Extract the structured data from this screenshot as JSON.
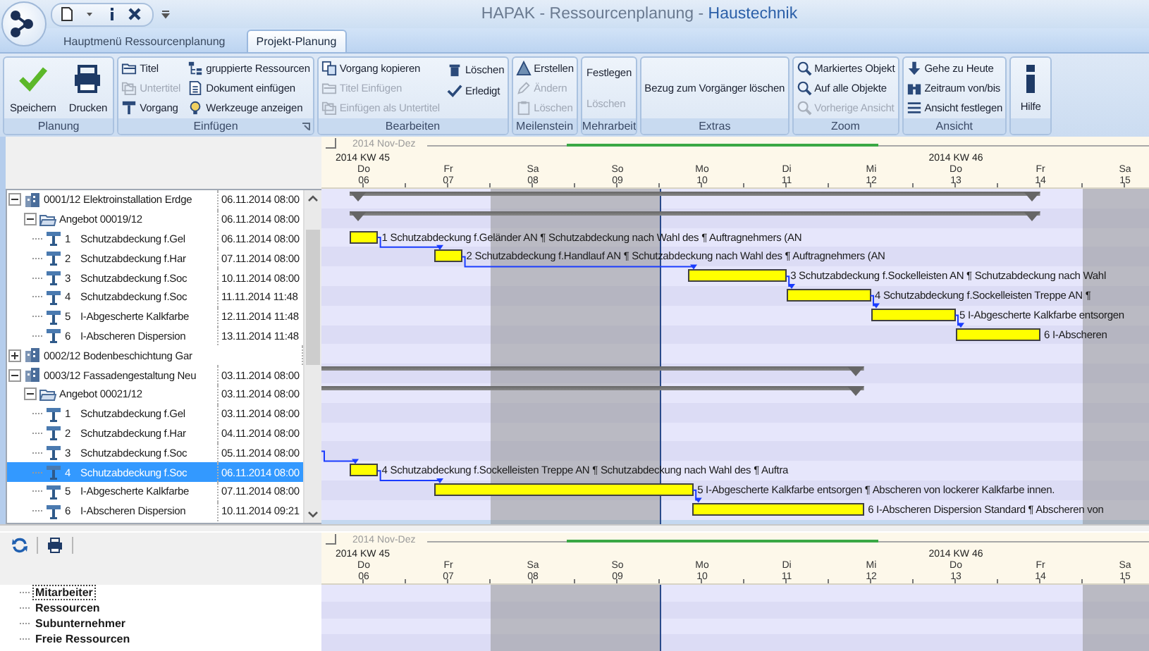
{
  "window": {
    "title": "HAPAK - Ressourcenplanung - ",
    "document": "Haustechnik"
  },
  "tabs": [
    {
      "label": "Hauptmenü Ressourcenplanung",
      "selected": false
    },
    {
      "label": "Projekt-Planung",
      "selected": true
    }
  ],
  "ribbon": {
    "groups": [
      {
        "label": "Planung",
        "columns": [
          [
            {
              "kind": "large",
              "label": "Speichern",
              "disabled": false
            }
          ],
          [
            {
              "kind": "large",
              "label": "Drucken",
              "disabled": false
            }
          ]
        ]
      },
      {
        "label": "Einfügen",
        "launcher": true,
        "columns": [
          [
            {
              "kind": "small",
              "label": "Titel",
              "disabled": false
            },
            {
              "kind": "small",
              "label": "Untertitel",
              "disabled": true
            },
            {
              "kind": "small",
              "label": "Vorgang",
              "disabled": false
            }
          ],
          [
            {
              "kind": "small",
              "label": "gruppierte Ressourcen",
              "disabled": false
            },
            {
              "kind": "small",
              "label": "Dokument einfügen",
              "disabled": false
            },
            {
              "kind": "small",
              "label": "Werkzeuge anzeigen",
              "disabled": false
            }
          ]
        ]
      },
      {
        "label": "Bearbeiten",
        "columns": [
          [
            {
              "kind": "small",
              "label": "Vorgang kopieren",
              "disabled": false
            },
            {
              "kind": "small",
              "label": "Titel Einfügen",
              "disabled": true
            },
            {
              "kind": "small",
              "label": "Einfügen als Untertitel",
              "disabled": true
            }
          ],
          [
            {
              "kind": "small",
              "label": "Löschen",
              "disabled": false
            },
            {
              "kind": "small",
              "label": "Erledigt",
              "disabled": false
            }
          ]
        ]
      },
      {
        "label": "Meilenstein",
        "columns": [
          [
            {
              "kind": "small",
              "label": "Erstellen",
              "disabled": false
            },
            {
              "kind": "small",
              "label": "Ändern",
              "disabled": true
            },
            {
              "kind": "small",
              "label": "Löschen",
              "disabled": true
            }
          ]
        ]
      },
      {
        "label": "Mehrarbeit",
        "columns": [
          [
            {
              "kind": "text",
              "label": "Festlegen",
              "disabled": false
            },
            {
              "kind": "text",
              "label": "Löschen",
              "disabled": true
            }
          ]
        ]
      },
      {
        "label": "Extras",
        "columns": [
          [
            {
              "kind": "text",
              "label": "Bezug zum Vorgänger löschen",
              "disabled": false
            }
          ]
        ]
      },
      {
        "label": "Zoom",
        "columns": [
          [
            {
              "kind": "small",
              "label": "Markiertes Objekt",
              "disabled": false
            },
            {
              "kind": "small",
              "label": "Auf alle Objekte",
              "disabled": false
            },
            {
              "kind": "small",
              "label": "Vorherige Ansicht",
              "disabled": true
            }
          ]
        ]
      },
      {
        "label": "Ansicht",
        "columns": [
          [
            {
              "kind": "small",
              "label": "Gehe zu Heute",
              "disabled": false
            },
            {
              "kind": "small",
              "label": "Zeitraum von/bis",
              "disabled": false
            },
            {
              "kind": "small",
              "label": "Ansicht festlegen",
              "disabled": false
            }
          ]
        ]
      },
      {
        "columns": [
          [
            {
              "kind": "large",
              "label": "Hilfe",
              "disabled": false
            }
          ]
        ]
      }
    ]
  },
  "tree": {
    "projects": [
      {
        "name": "0001/12 Elektroinstallation Erdge",
        "date": "06.11.2014 08:00",
        "expanded": true,
        "selected": false,
        "children": [
          {
            "name": "Angebot 00019/12",
            "date": "06.11.2014 08:00",
            "expanded": true,
            "selected": false,
            "children": [
              {
                "number": "1",
                "name": "Schutzabdeckung f.Gel",
                "date": "06.11.2014 08:00",
                "selected": false,
                "bar_label": "1 Schutzabdeckung f.Geländer AN ¶ Schutzabdeckung nach Wahl des ¶ Auftragnehmers (AN"
              },
              {
                "number": "2",
                "name": "Schutzabdeckung f.Har",
                "date": "07.11.2014 08:00",
                "selected": false,
                "bar_label": "2 Schutzabdeckung f.Handlauf AN ¶ Schutzabdeckung nach Wahl des ¶ Auftragnehmers (AN"
              },
              {
                "number": "3",
                "name": "Schutzabdeckung f.Soc",
                "date": "10.11.2014 08:00",
                "selected": false,
                "bar_label": "3 Schutzabdeckung f.Sockelleisten AN ¶ Schutzabdeckung nach Wahl"
              },
              {
                "number": "4",
                "name": "Schutzabdeckung f.Soc",
                "date": "11.11.2014 11:48",
                "selected": false,
                "bar_label": "4 Schutzabdeckung f.Sockelleisten Treppe AN ¶"
              },
              {
                "number": "5",
                "name": "I-Abgescherte Kalkfarbe",
                "date": "12.11.2014 11:48",
                "selected": false,
                "bar_label": "5 I-Abgescherte Kalkfarbe entsorgen"
              },
              {
                "number": "6",
                "name": "I-Abscheren Dispersion",
                "date": "13.11.2014 11:48",
                "selected": false,
                "bar_label": "6 I-Abscheren"
              }
            ]
          }
        ]
      },
      {
        "name": "0002/12 Bodenbeschichtung Gar",
        "expanded": false,
        "selected": false
      },
      {
        "name": "0003/12 Fassadengestaltung Neu",
        "date": "03.11.2014 08:00",
        "expanded": true,
        "selected": false,
        "children": [
          {
            "name": "Angebot 00021/12",
            "date": "03.11.2014 08:00",
            "expanded": true,
            "selected": false,
            "children": [
              {
                "number": "1",
                "name": "Schutzabdeckung f.Gel",
                "date": "03.11.2014 08:00",
                "selected": false
              },
              {
                "number": "2",
                "name": "Schutzabdeckung f.Har",
                "date": "04.11.2014 08:00",
                "selected": false
              },
              {
                "number": "3",
                "name": "Schutzabdeckung f.Soc",
                "date": "05.11.2014 08:00",
                "selected": false
              },
              {
                "number": "4",
                "name": "Schutzabdeckung f.Soc",
                "date": "06.11.2014 08:00",
                "selected": true,
                "bar_label": "4 Schutzabdeckung f.Sockelleisten Treppe AN ¶ Schutzabdeckung nach Wahl des ¶ Auftra"
              },
              {
                "number": "5",
                "name": "I-Abgescherte Kalkfarbe",
                "date": "07.11.2014 08:00",
                "selected": false,
                "bar_label": "5 I-Abgescherte Kalkfarbe entsorgen ¶ Abscheren von lockerer Kalkfarbe innen."
              },
              {
                "number": "6",
                "name": "I-Abscheren Dispersion",
                "date": "10.11.2014 09:21",
                "selected": false,
                "bar_label": "6 I-Abscheren Dispersion Standard ¶ Abscheren von"
              }
            ]
          }
        ]
      }
    ]
  },
  "chart": {
    "period": "2014 Nov-Dez",
    "weeks": [
      "2014 KW 45",
      "2014 KW 46"
    ],
    "days": [
      {
        "name": "Do",
        "date": "06",
        "weekend": false
      },
      {
        "name": "Fr",
        "date": "07",
        "weekend": false
      },
      {
        "name": "Sa",
        "date": "08",
        "weekend": true
      },
      {
        "name": "So",
        "date": "09",
        "weekend": true
      },
      {
        "name": "Mo",
        "date": "10",
        "weekend": false
      },
      {
        "name": "Di",
        "date": "11",
        "weekend": false
      },
      {
        "name": "Mi",
        "date": "12",
        "weekend": false
      },
      {
        "name": "Do",
        "date": "13",
        "weekend": false
      },
      {
        "name": "Fr",
        "date": "14",
        "weekend": false
      },
      {
        "name": "Sa",
        "date": "15",
        "weekend": true
      }
    ]
  },
  "resources": {
    "items": [
      {
        "label": "Mitarbeiter",
        "selected": true
      },
      {
        "label": "Ressourcen",
        "selected": false
      },
      {
        "label": "Subunternehmer",
        "selected": false
      },
      {
        "label": "Freie Ressourcen",
        "selected": false
      }
    ]
  },
  "resource_chart": {
    "period": "2014 Nov-Dez",
    "weeks": [
      "2014 KW 45",
      "2014 KW 46"
    ],
    "days": [
      {
        "name": "Do",
        "date": "06",
        "weekend": false
      },
      {
        "name": "Fr",
        "date": "07",
        "weekend": false
      },
      {
        "name": "Sa",
        "date": "08",
        "weekend": true
      },
      {
        "name": "So",
        "date": "09",
        "weekend": true
      },
      {
        "name": "Mo",
        "date": "10",
        "weekend": false
      },
      {
        "name": "Di",
        "date": "11",
        "weekend": false
      },
      {
        "name": "Mi",
        "date": "12",
        "weekend": false
      },
      {
        "name": "Do",
        "date": "13",
        "weekend": false
      },
      {
        "name": "Fr",
        "date": "14",
        "weekend": false
      },
      {
        "name": "Sa",
        "date": "15",
        "weekend": true
      }
    ]
  }
}
